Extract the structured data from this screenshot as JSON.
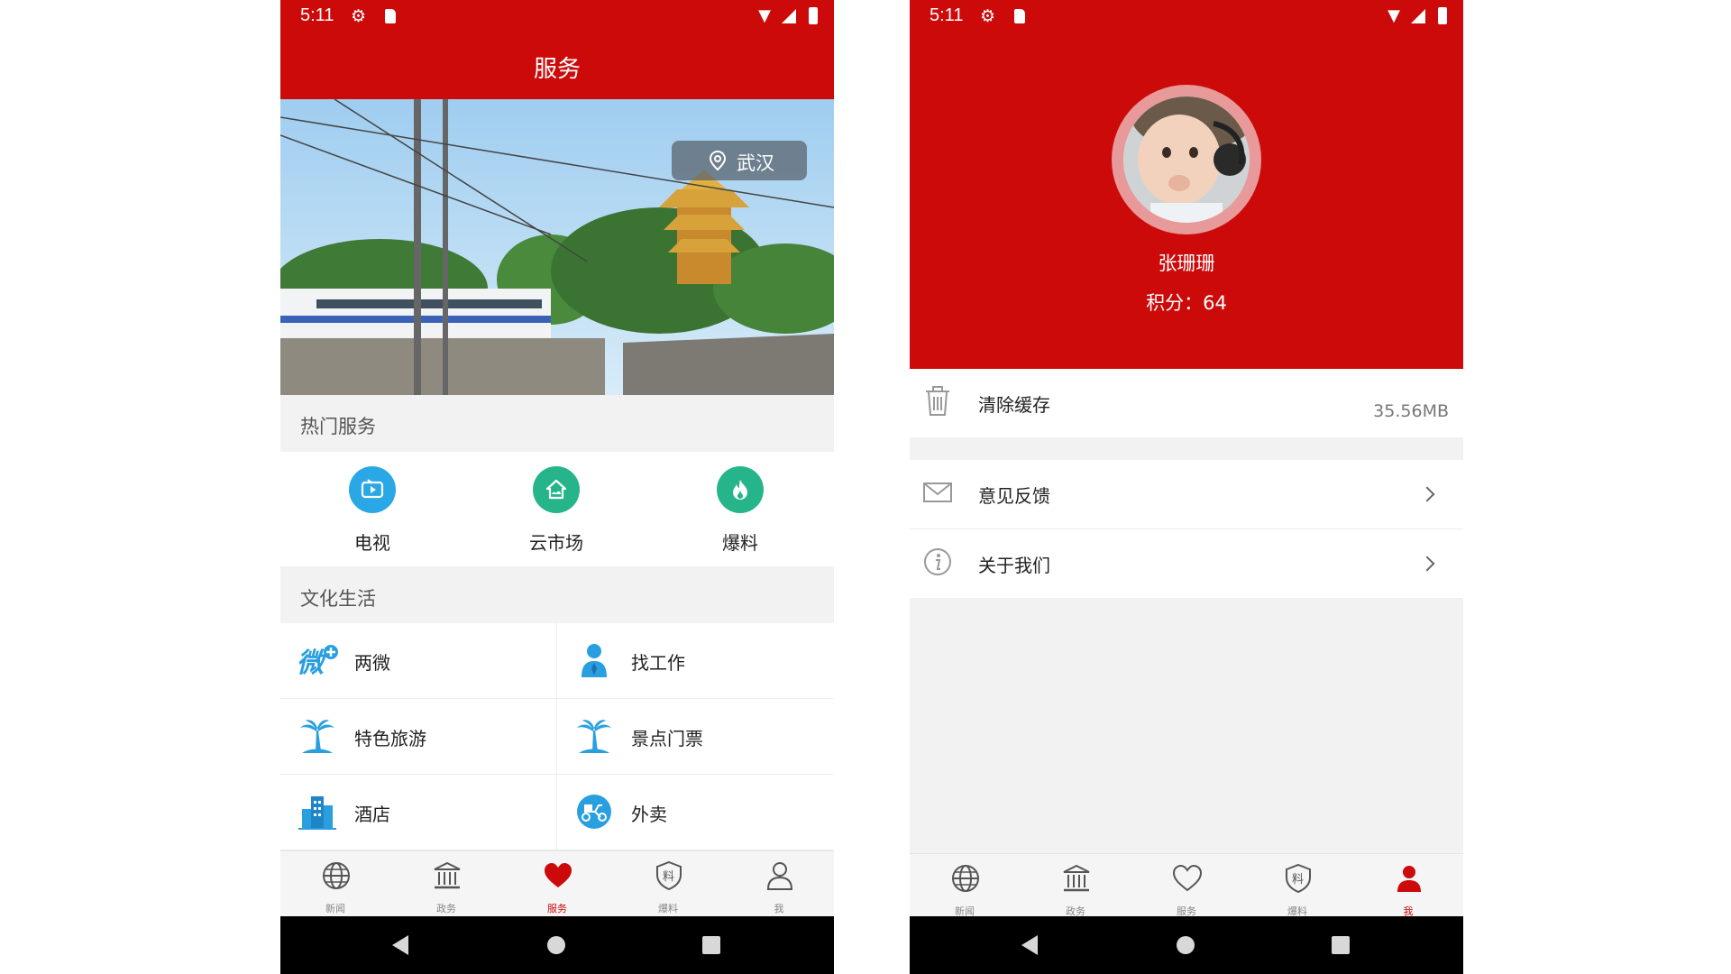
{
  "status_bar": {
    "time": "5:11"
  },
  "services_screen": {
    "title": "服务",
    "banner_location": "武汉",
    "hot_section_title": "热门服务",
    "hot_services": [
      {
        "label": "电视",
        "icon": "tv-icon",
        "color": "#2aa8e6"
      },
      {
        "label": "云市场",
        "icon": "cloud-market-icon",
        "color": "#26b58a"
      },
      {
        "label": "爆料",
        "icon": "flame-icon",
        "color": "#26b58a"
      }
    ],
    "life_section_title": "文化生活",
    "life_services": [
      {
        "label": "两微",
        "icon": "weibo-wechat-icon"
      },
      {
        "label": "找工作",
        "icon": "job-person-icon"
      },
      {
        "label": "特色旅游",
        "icon": "palm-tree-icon"
      },
      {
        "label": "景点门票",
        "icon": "palm-tree-icon"
      },
      {
        "label": "酒店",
        "icon": "hotel-building-icon"
      },
      {
        "label": "外卖",
        "icon": "scooter-icon"
      }
    ]
  },
  "tab_bar": {
    "tabs": [
      {
        "label": "新闻",
        "icon": "globe-icon"
      },
      {
        "label": "政务",
        "icon": "government-icon"
      },
      {
        "label": "服务",
        "icon": "heart-icon"
      },
      {
        "label": "爆料",
        "icon": "shield-icon"
      },
      {
        "label": "我",
        "icon": "person-icon"
      }
    ],
    "active_left": "服务",
    "active_right": "我"
  },
  "profile_screen": {
    "name": "张珊珊",
    "points": "积分：64",
    "clear_cache_label": "清除缓存",
    "cache_size": "35.56MB",
    "feedback_label": "意见反馈",
    "about_label": "关于我们"
  },
  "colors": {
    "brand_red": "#cc0a0a",
    "accent_blue": "#2aa8e6",
    "accent_green": "#26b58a"
  }
}
